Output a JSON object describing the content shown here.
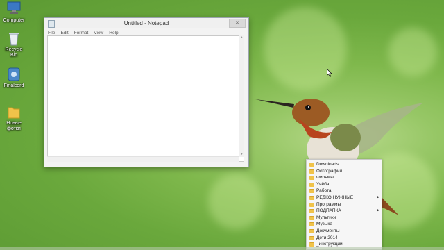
{
  "desktop": {
    "icons": [
      {
        "label": "Computer",
        "icon": "computer-icon"
      },
      {
        "label": "Recycle Bin",
        "icon": "recycle-bin-icon"
      },
      {
        "label": "Finalcord",
        "icon": "app-icon"
      },
      {
        "label": "Новые",
        "label2": "фотки",
        "icon": "folder-icon"
      }
    ]
  },
  "notepad": {
    "title": "Untitled - Notepad",
    "close": "×",
    "menu": [
      "File",
      "Edit",
      "Format",
      "View",
      "Help"
    ],
    "text": ""
  },
  "jumplist": {
    "items": [
      {
        "label": "Downloads",
        "submenu": false
      },
      {
        "label": "Фотографии",
        "submenu": false
      },
      {
        "label": "Фильмы",
        "submenu": false
      },
      {
        "label": "Учёба",
        "submenu": false
      },
      {
        "label": "Работа",
        "submenu": false
      },
      {
        "label": "РЕДКО НУЖНЫЕ",
        "submenu": true
      },
      {
        "label": "Программы",
        "submenu": false
      },
      {
        "label": "ПОДПАПКА",
        "submenu": true
      },
      {
        "label": "Мультики",
        "submenu": false
      },
      {
        "label": "Музыка",
        "submenu": false
      },
      {
        "label": "Документы",
        "submenu": false
      },
      {
        "label": "Дети 2014",
        "submenu": false
      },
      {
        "label": "_инструкции",
        "submenu": false
      }
    ]
  },
  "colors": {
    "wallpaper": "#7fb84c",
    "folder": "#f0c34a",
    "window_border": "#9aa4ad"
  }
}
